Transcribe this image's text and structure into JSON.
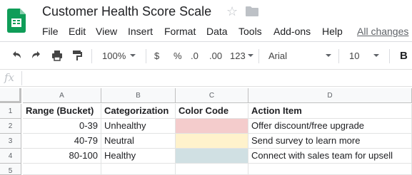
{
  "doc": {
    "title": "Customer Health Score Scale",
    "all_changes": "All changes"
  },
  "menu": [
    "File",
    "Edit",
    "View",
    "Insert",
    "Format",
    "Data",
    "Tools",
    "Add-ons",
    "Help"
  ],
  "toolbar": {
    "zoom": "100%",
    "currency": "$",
    "percent": "%",
    "decrease_decimal": ".0",
    "increase_decimal": ".00",
    "more_formats": "123",
    "font": "Arial",
    "font_size": "10",
    "bold": "B"
  },
  "formula_bar": {
    "fx": "fx"
  },
  "columns": [
    "A",
    "B",
    "C",
    "D"
  ],
  "rows": [
    "1",
    "2",
    "3",
    "4",
    "5"
  ],
  "table": {
    "header": [
      "Range (Bucket)",
      "Categorization",
      "Color Code",
      "Action Item"
    ],
    "data": [
      [
        "0-39",
        "Unhealthy",
        "",
        "Offer discount/free upgrade"
      ],
      [
        "40-79",
        "Neutral",
        "",
        "Send survey to learn more"
      ],
      [
        "80-100",
        "Healthy",
        "",
        "Connect with sales team for upsell"
      ]
    ],
    "color_codes": [
      "#f4cccc",
      "#fff2cc",
      "#d0e0e3"
    ]
  }
}
